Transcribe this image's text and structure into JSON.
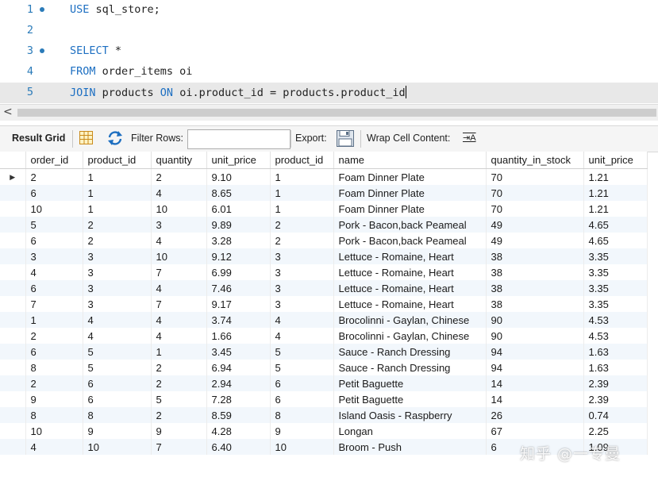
{
  "editor": {
    "lines": [
      {
        "number": "1",
        "kw": "USE",
        "rest": " sql_store;"
      },
      {
        "number": "2",
        "kw": "",
        "rest": ""
      },
      {
        "number": "3",
        "kw": "SELECT",
        "rest": " *"
      },
      {
        "number": "4",
        "kw": "FROM",
        "rest": " order_items oi"
      },
      {
        "number": "5",
        "kw": "JOIN",
        "rest": " products ",
        "kw2": "ON",
        "rest2": " oi.product_id = products.product_id"
      }
    ]
  },
  "scroll_arrow": "<",
  "toolbar": {
    "result_grid": "Result Grid",
    "filter_rows": "Filter Rows:",
    "filter_value": "",
    "export": "Export:",
    "wrap_cell": "Wrap Cell Content:",
    "wrap_icon_glyph": "⇥A"
  },
  "grid": {
    "columns": [
      "order_id",
      "product_id",
      "quantity",
      "unit_price",
      "product_id",
      "name",
      "quantity_in_stock",
      "unit_price"
    ],
    "rows": [
      [
        "2",
        "1",
        "2",
        "9.10",
        "1",
        "Foam Dinner Plate",
        "70",
        "1.21"
      ],
      [
        "6",
        "1",
        "4",
        "8.65",
        "1",
        "Foam Dinner Plate",
        "70",
        "1.21"
      ],
      [
        "10",
        "1",
        "10",
        "6.01",
        "1",
        "Foam Dinner Plate",
        "70",
        "1.21"
      ],
      [
        "5",
        "2",
        "3",
        "9.89",
        "2",
        "Pork - Bacon,back Peameal",
        "49",
        "4.65"
      ],
      [
        "6",
        "2",
        "4",
        "3.28",
        "2",
        "Pork - Bacon,back Peameal",
        "49",
        "4.65"
      ],
      [
        "3",
        "3",
        "10",
        "9.12",
        "3",
        "Lettuce - Romaine, Heart",
        "38",
        "3.35"
      ],
      [
        "4",
        "3",
        "7",
        "6.99",
        "3",
        "Lettuce - Romaine, Heart",
        "38",
        "3.35"
      ],
      [
        "6",
        "3",
        "4",
        "7.46",
        "3",
        "Lettuce - Romaine, Heart",
        "38",
        "3.35"
      ],
      [
        "7",
        "3",
        "7",
        "9.17",
        "3",
        "Lettuce - Romaine, Heart",
        "38",
        "3.35"
      ],
      [
        "1",
        "4",
        "4",
        "3.74",
        "4",
        "Brocolinni - Gaylan, Chinese",
        "90",
        "4.53"
      ],
      [
        "2",
        "4",
        "4",
        "1.66",
        "4",
        "Brocolinni - Gaylan, Chinese",
        "90",
        "4.53"
      ],
      [
        "6",
        "5",
        "1",
        "3.45",
        "5",
        "Sauce - Ranch Dressing",
        "94",
        "1.63"
      ],
      [
        "8",
        "5",
        "2",
        "6.94",
        "5",
        "Sauce - Ranch Dressing",
        "94",
        "1.63"
      ],
      [
        "2",
        "6",
        "2",
        "2.94",
        "6",
        "Petit Baguette",
        "14",
        "2.39"
      ],
      [
        "9",
        "6",
        "5",
        "7.28",
        "6",
        "Petit Baguette",
        "14",
        "2.39"
      ],
      [
        "8",
        "8",
        "2",
        "8.59",
        "8",
        "Island Oasis - Raspberry",
        "26",
        "0.74"
      ],
      [
        "10",
        "9",
        "9",
        "4.28",
        "9",
        "Longan",
        "67",
        "2.25"
      ],
      [
        "4",
        "10",
        "7",
        "6.40",
        "10",
        "Broom - Push",
        "6",
        "1.09"
      ]
    ],
    "current_row_marker": "▶"
  },
  "watermark": "知乎 @一专曼",
  "colors": {
    "keyword": "#1d6fc2",
    "line_number": "#2b7bb9",
    "highlight_line": "#e8e8e8",
    "odd_row": "#f2f7fc"
  }
}
